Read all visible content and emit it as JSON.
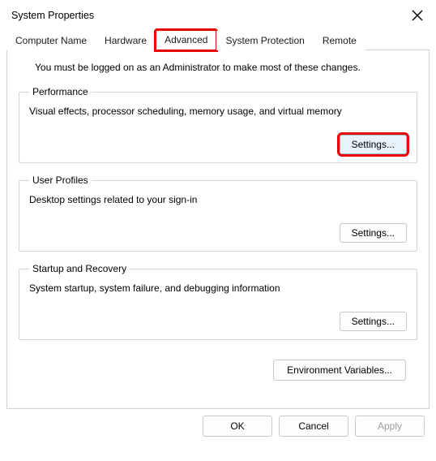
{
  "window": {
    "title": "System Properties"
  },
  "tabs": {
    "computer_name": "Computer Name",
    "hardware": "Hardware",
    "advanced": "Advanced",
    "system_protection": "System Protection",
    "remote": "Remote"
  },
  "notice": "You must be logged on as an Administrator to make most of these changes.",
  "groups": {
    "performance": {
      "legend": "Performance",
      "desc": "Visual effects, processor scheduling, memory usage, and virtual memory",
      "button": "Settings..."
    },
    "user_profiles": {
      "legend": "User Profiles",
      "desc": "Desktop settings related to your sign-in",
      "button": "Settings..."
    },
    "startup": {
      "legend": "Startup and Recovery",
      "desc": "System startup, system failure, and debugging information",
      "button": "Settings..."
    }
  },
  "env_button": "Environment Variables...",
  "footer": {
    "ok": "OK",
    "cancel": "Cancel",
    "apply": "Apply"
  }
}
